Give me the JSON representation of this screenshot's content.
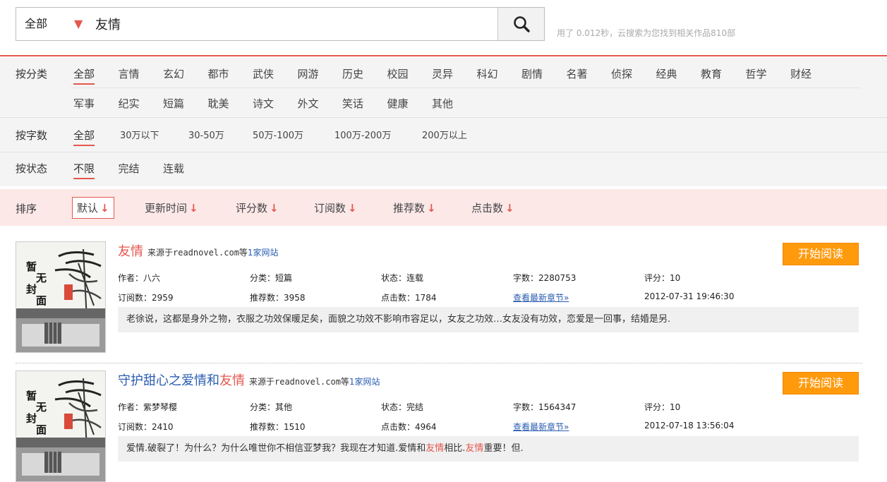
{
  "search": {
    "scope": "全部",
    "query": "友情",
    "result_info": "用了 0.012秒，云搜索为您找到相关作品810部"
  },
  "filters": {
    "category_label": "按分类",
    "categories_row1": [
      "全部",
      "言情",
      "玄幻",
      "都市",
      "武侠",
      "网游",
      "历史",
      "校园",
      "灵异",
      "科幻",
      "剧情",
      "名著",
      "侦探",
      "经典",
      "教育",
      "哲学",
      "财经"
    ],
    "categories_row2": [
      "军事",
      "纪实",
      "短篇",
      "耽美",
      "诗文",
      "外文",
      "笑话",
      "健康",
      "其他"
    ],
    "wordcount_label": "按字数",
    "wordcounts": [
      "全部",
      "30万以下",
      "30-50万",
      "50万-100万",
      "100万-200万",
      "200万以上"
    ],
    "status_label": "按状态",
    "statuses": [
      "不限",
      "完结",
      "连载"
    ]
  },
  "sort": {
    "label": "排序",
    "items": [
      "默认",
      "更新时间",
      "评分数",
      "订阅数",
      "推荐数",
      "点击数"
    ],
    "arrow": "↓"
  },
  "results": [
    {
      "title_plain": "",
      "title_hl": "友情",
      "source_prefix": "来源于readnovel.com等",
      "source_link": "1家网站",
      "author": "作者：八六",
      "category": "分类：短篇",
      "status": "状态：连载",
      "words": "字数：2280753",
      "score": "评分：10",
      "subs": "订阅数：2959",
      "recs": "推荐数：3958",
      "clicks": "点击数：1784",
      "latest": "查看最新章节»",
      "updated": "2012-07-31 19:46:30",
      "desc_parts": [
        "老徐说，这都是身外之物，衣服之功效保暖足矣，面貌之功效不影响市容足以，女友之功效…女友没有功效，恋爱是一回事，结婚是另."
      ],
      "read_label": "开始阅读",
      "cover_text": "暂无封面"
    },
    {
      "title_plain": "守护甜心之爱情和",
      "title_hl": "友情",
      "source_prefix": "来源于readnovel.com等",
      "source_link": "1家网站",
      "author": "作者：紫梦琴樱",
      "category": "分类：其他",
      "status": "状态：完结",
      "words": "字数：1564347",
      "score": "评分：10",
      "subs": "订阅数：2410",
      "recs": "推荐数：1510",
      "clicks": "点击数：4964",
      "latest": "查看最新章节»",
      "updated": "2012-07-18 13:56:04",
      "desc_parts": [
        "爱情.破裂了！为什么？为什么唯世你不相信亚梦我？我现在才知道.爱情和",
        "友情",
        "相比.",
        "友情",
        "重要！但."
      ],
      "read_label": "开始阅读",
      "cover_text": "暂无封面"
    }
  ],
  "colors": {
    "accent": "#e4574d",
    "link": "#2a5db0",
    "button": "#ff9a0d",
    "sort_bg": "#fde8e8"
  }
}
